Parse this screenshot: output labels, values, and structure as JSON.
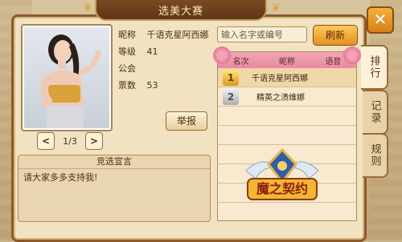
{
  "window": {
    "title": "选美大赛"
  },
  "close_label": "✕",
  "side_tabs": [
    {
      "label": "排行",
      "active": true
    },
    {
      "label": "记录",
      "active": false
    },
    {
      "label": "规则",
      "active": false
    }
  ],
  "profile": {
    "fields": [
      {
        "label": "昵称",
        "value": "千语克星阿西娜"
      },
      {
        "label": "等级",
        "value": "41"
      },
      {
        "label": "公会",
        "value": ""
      },
      {
        "label": "票数",
        "value": "53"
      }
    ],
    "report_label": "举报"
  },
  "pager": {
    "prev": "<",
    "current": "1/3",
    "next": ">"
  },
  "declaration": {
    "title": "竞选宣言",
    "text": "请大家多多支持我!"
  },
  "search": {
    "placeholder": "输入名字或编号",
    "refresh_label": "刷新"
  },
  "ranking": {
    "headers": [
      "名次",
      "昵称",
      "语音"
    ],
    "rows": [
      {
        "rank": "1",
        "name": "千语克星阿西娜"
      },
      {
        "rank": "2",
        "name": "精英之渍维娜"
      }
    ]
  },
  "logo_text": "魔之契约",
  "colors": {
    "accent": "#e4921f",
    "panel": "#f1e2c2",
    "border": "#8a5a2b",
    "header_pink": "#e88aa0"
  }
}
